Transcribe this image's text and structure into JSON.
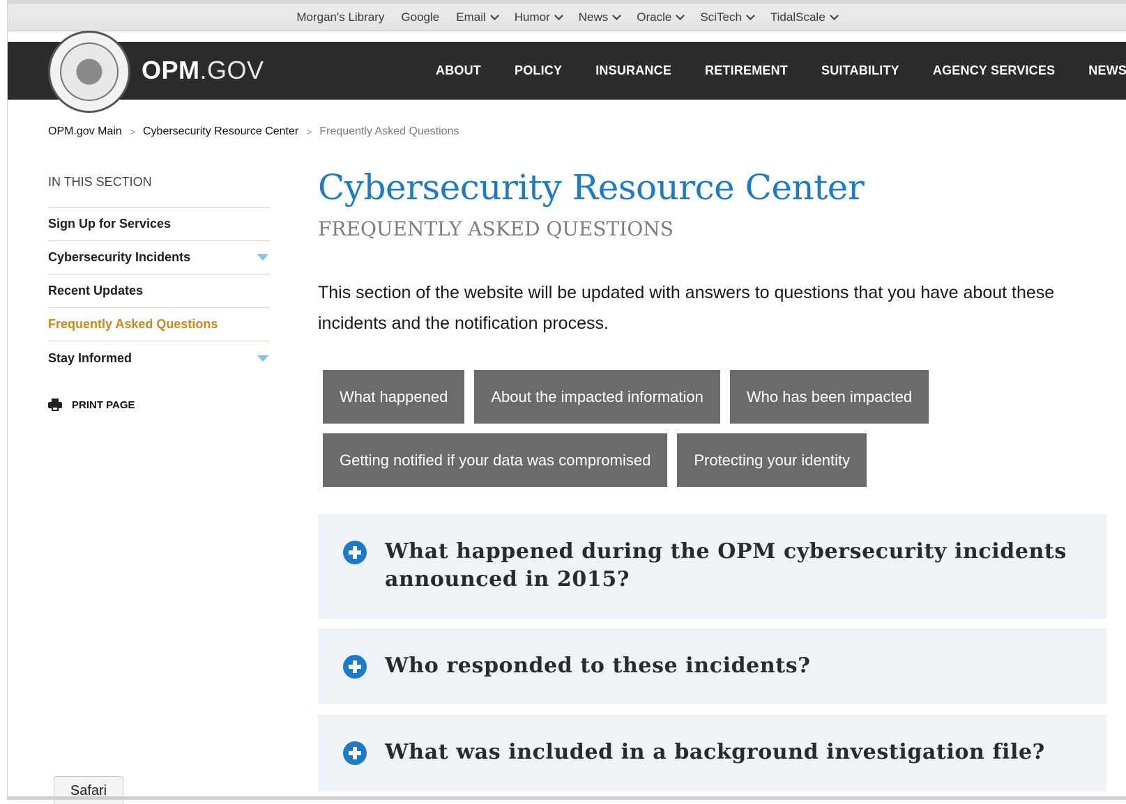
{
  "bookmarks": [
    {
      "label": "Morgan's Library",
      "has_menu": false
    },
    {
      "label": "Google",
      "has_menu": false
    },
    {
      "label": "Email",
      "has_menu": true
    },
    {
      "label": "Humor",
      "has_menu": true
    },
    {
      "label": "News",
      "has_menu": true
    },
    {
      "label": "Oracle",
      "has_menu": true
    },
    {
      "label": "SciTech",
      "has_menu": true
    },
    {
      "label": "TidalScale",
      "has_menu": true
    }
  ],
  "header": {
    "logo_bold": "OPM",
    "logo_light": ".GOV",
    "nav": [
      "ABOUT",
      "POLICY",
      "INSURANCE",
      "RETIREMENT",
      "SUITABILITY",
      "AGENCY SERVICES",
      "NEWS"
    ]
  },
  "breadcrumb": [
    "OPM.gov Main",
    "Cybersecurity Resource Center",
    "Frequently Asked Questions"
  ],
  "sidebar": {
    "section_title": "IN THIS SECTION",
    "items": [
      {
        "label": "Sign Up for Services",
        "expandable": false,
        "active": false
      },
      {
        "label": "Cybersecurity Incidents",
        "expandable": true,
        "active": false
      },
      {
        "label": "Recent Updates",
        "expandable": false,
        "active": false
      },
      {
        "label": "Frequently Asked Questions",
        "expandable": false,
        "active": true
      },
      {
        "label": "Stay Informed",
        "expandable": true,
        "active": false
      }
    ],
    "print_label": "PRINT PAGE"
  },
  "main": {
    "title": "Cybersecurity Resource Center",
    "subtitle": "FREQUENTLY ASKED QUESTIONS",
    "intro": "This section of the website will be updated with answers to questions that you have about these incidents and the notification process.",
    "tiles": [
      [
        "What happened",
        "About the impacted information",
        "Who has been impacted"
      ],
      [
        "Getting notified if your data was compromised",
        "Protecting your identity"
      ]
    ],
    "faqs": [
      {
        "line1": "What happened during the OPM cybersecurity incidents",
        "line2": "announced in 2015?"
      },
      {
        "line1": "Who responded to these incidents?",
        "line2": ""
      },
      {
        "line1": "What was included in a background investigation file?",
        "line2": ""
      }
    ]
  },
  "browser": {
    "tab_label": "Safari"
  },
  "colors": {
    "accent": "#1c7bc9",
    "active": "#c8891a",
    "header_bg": "#2b2b2b",
    "tile_bg": "#6b6b6b",
    "faq_bg": "#eef3f7"
  }
}
